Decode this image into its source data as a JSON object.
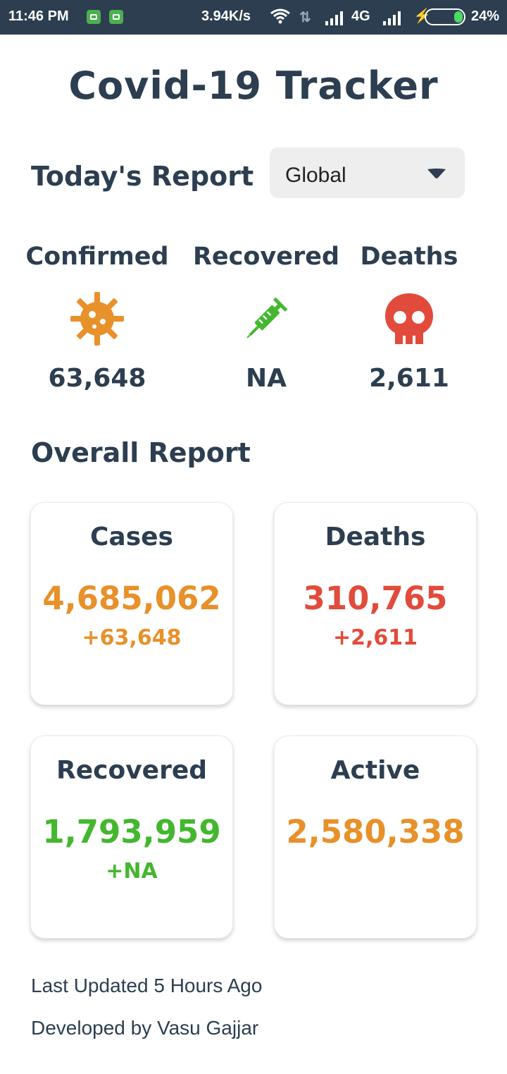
{
  "status_bar": {
    "time": "11:46 PM",
    "speed": "3.94K/s",
    "network": "4G",
    "battery": "24%",
    "battery_level": 0.24
  },
  "app": {
    "title": "Covid-19 Tracker"
  },
  "today": {
    "heading": "Today's Report",
    "region_select": "Global",
    "stats": [
      {
        "label": "Confirmed",
        "value": "63,648",
        "icon": "virus-icon",
        "color": "#e8902a"
      },
      {
        "label": "Recovered",
        "value": "NA",
        "icon": "syringe-icon",
        "color": "#43b72e"
      },
      {
        "label": "Deaths",
        "value": "2,611",
        "icon": "skull-icon",
        "color": "#e24b3b"
      }
    ]
  },
  "overall": {
    "heading": "Overall Report",
    "cards": [
      {
        "title": "Cases",
        "value": "4,685,062",
        "delta": "+63,648",
        "color": "#e8902a"
      },
      {
        "title": "Deaths",
        "value": "310,765",
        "delta": "+2,611",
        "color": "#e24b3b"
      },
      {
        "title": "Recovered",
        "value": "1,793,959",
        "delta": "+NA",
        "color": "#43b72e"
      },
      {
        "title": "Active",
        "value": "2,580,338",
        "delta": "",
        "color": "#e8902a"
      }
    ]
  },
  "footer": {
    "updated": "Last Updated 5 Hours Ago",
    "developer": "Developed by Vasu Gajjar"
  }
}
